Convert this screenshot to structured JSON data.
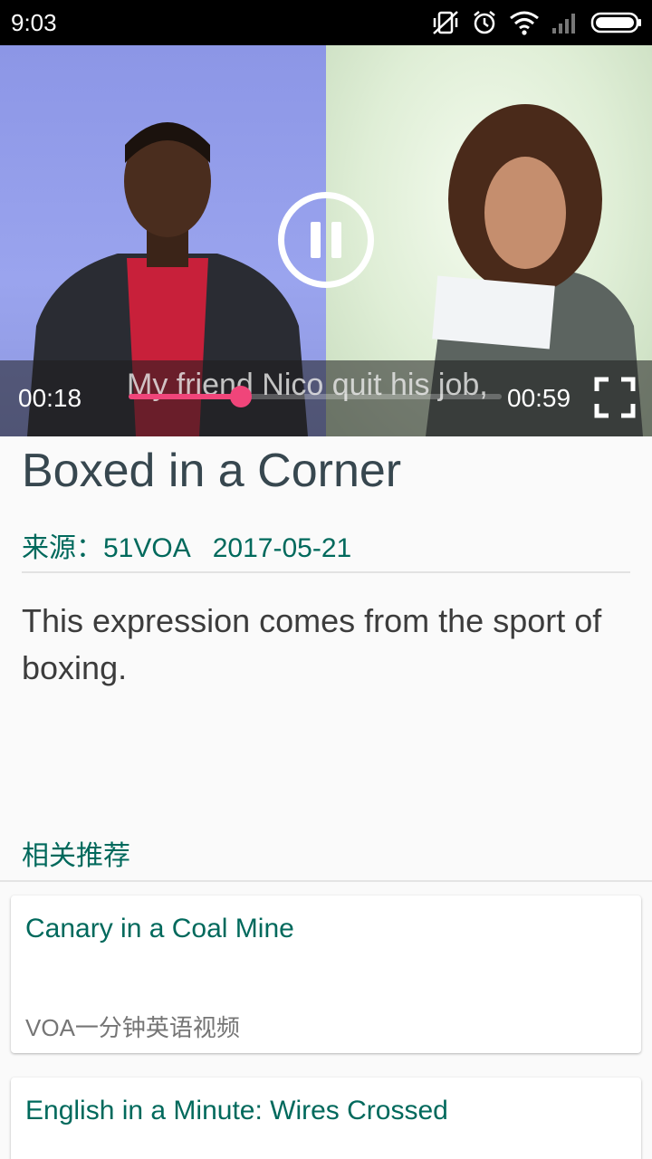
{
  "status_bar": {
    "time": "9:03",
    "icons": [
      "mute-vibrate-icon",
      "alarm-icon",
      "wifi-icon",
      "cell-signal-icon",
      "battery-icon"
    ]
  },
  "video": {
    "state": "playing",
    "caption": "My friend Nico quit his job,",
    "current_time": "00:18",
    "total_time": "00:59",
    "progress": 0.3,
    "accent_color": "#f0457a"
  },
  "article": {
    "title": "Boxed in a Corner",
    "source": "来源：51VOA",
    "date": "2017-05-21",
    "summary": "This expression comes from the sport of boxing."
  },
  "related": {
    "heading": "相关推荐",
    "items": [
      {
        "title": "Canary in a Coal Mine",
        "source": "VOA一分钟英语视频"
      },
      {
        "title": "English in a Minute: Wires Crossed",
        "source": ""
      }
    ]
  },
  "colors": {
    "accent_teal": "#00695c",
    "title_text": "#37474f"
  }
}
